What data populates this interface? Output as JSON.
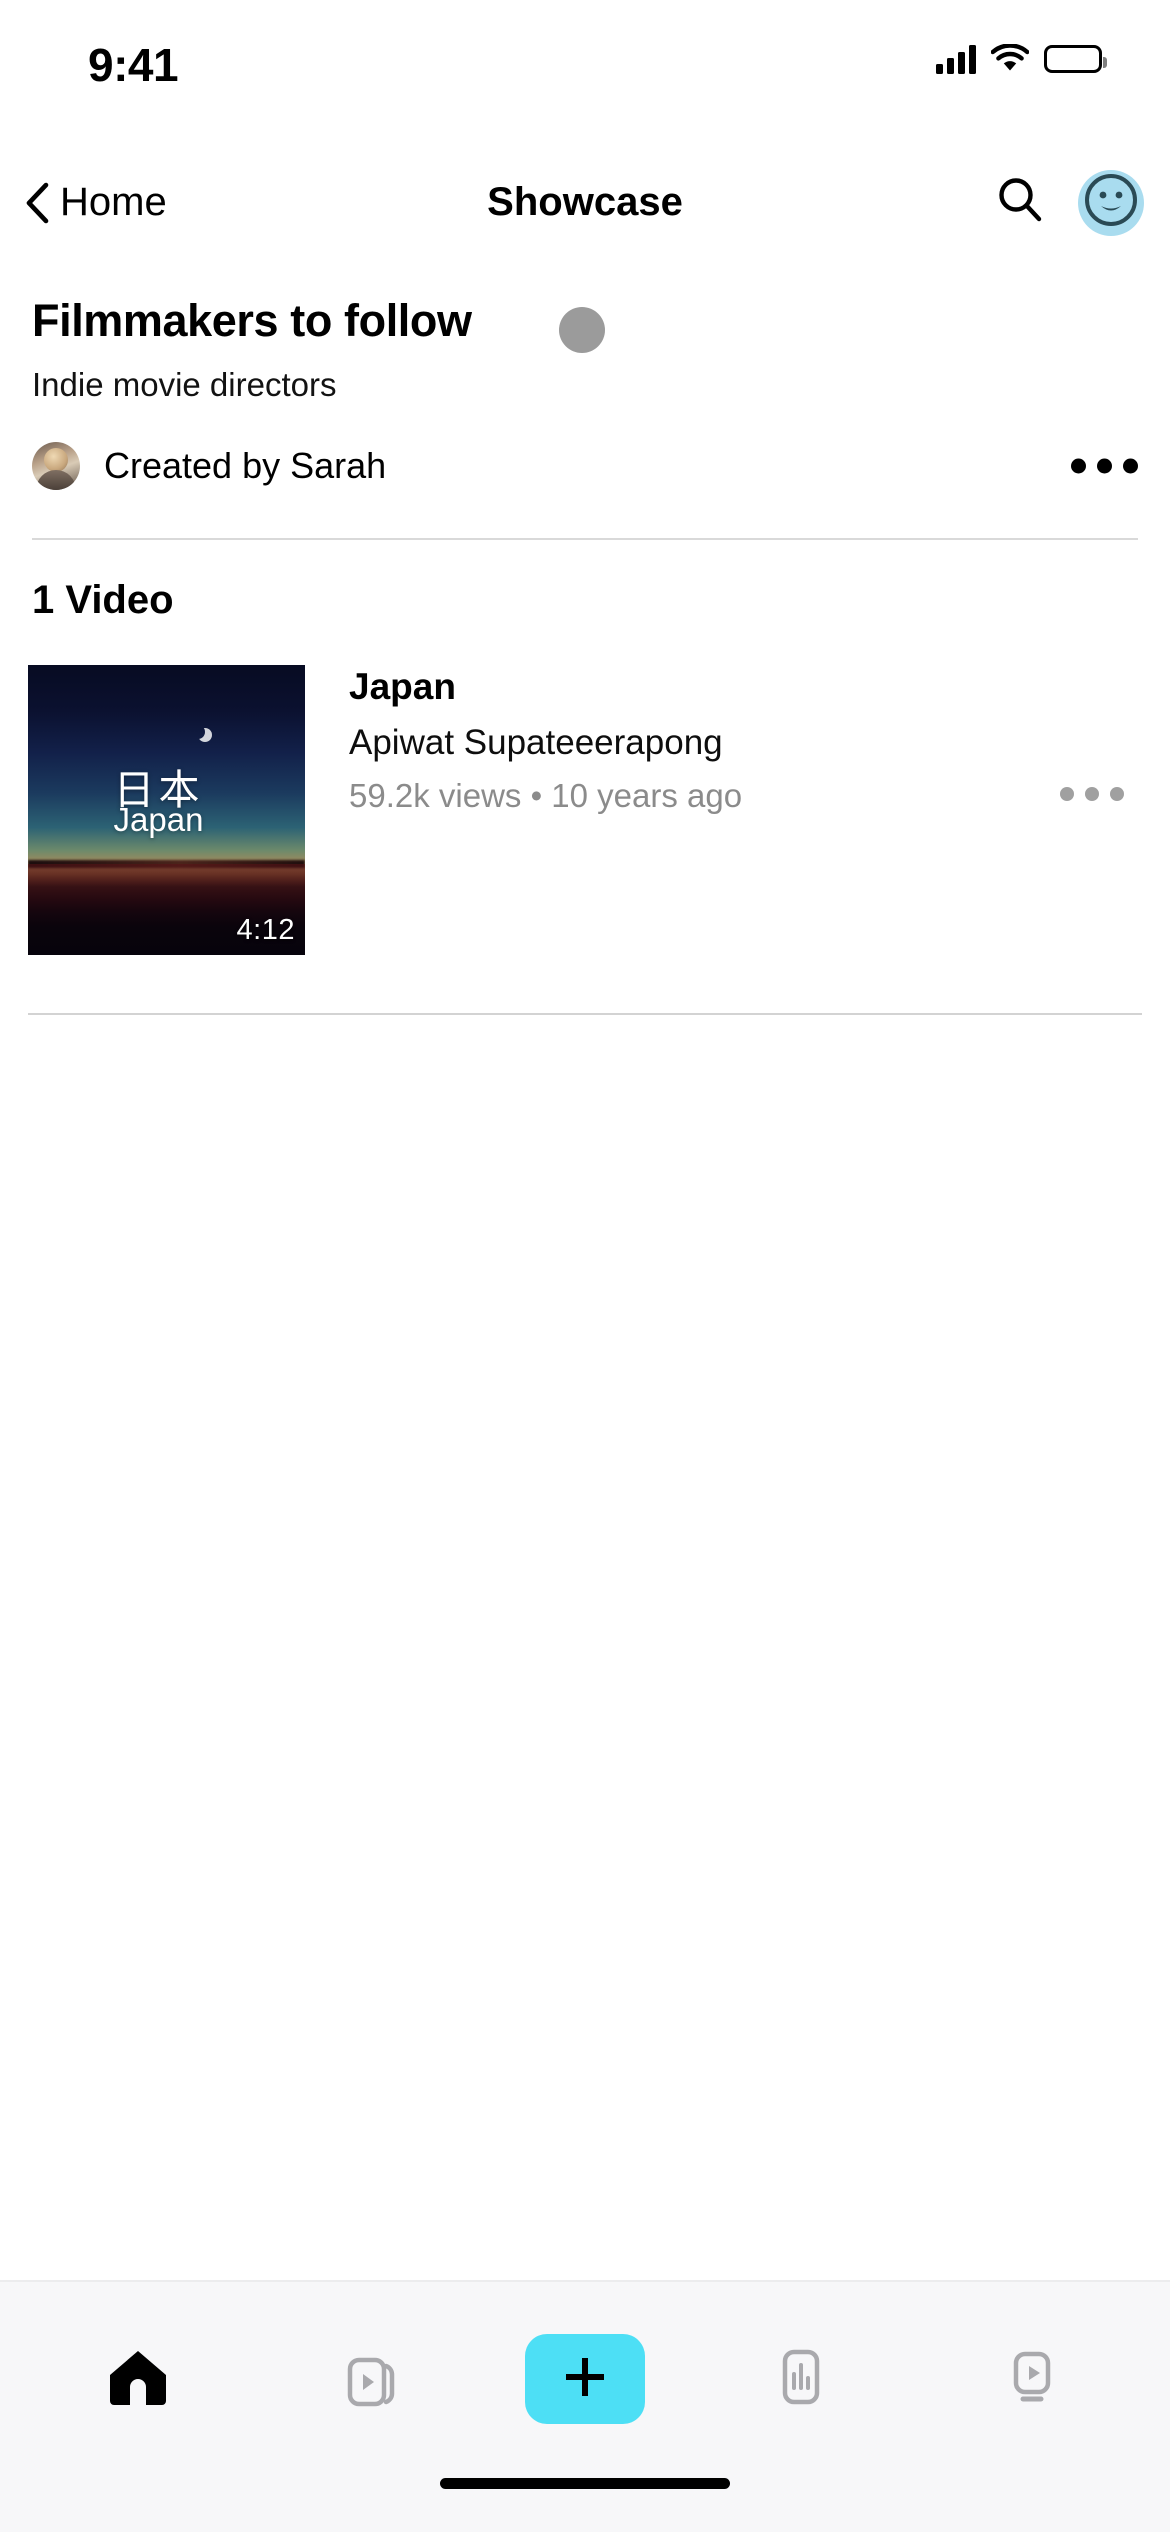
{
  "status_bar": {
    "time": "9:41",
    "cellular_icon": "signal-bars-icon",
    "wifi_icon": "wifi-icon",
    "battery_icon": "battery-full-icon"
  },
  "nav_bar": {
    "back_icon": "chevron-left-icon",
    "back_label": "Home",
    "title": "Showcase",
    "search_icon": "search-icon",
    "avatar_icon": "profile-avatar-icon",
    "avatar_bg": "#a9dcef"
  },
  "playlist": {
    "title": "Filmmakers to follow",
    "subtitle": "Indie movie directors",
    "creator_label": "Created by Sarah",
    "creator_avatar_icon": "creator-avatar-icon",
    "more_icon": "more-horizontal-icon",
    "placeholder_dot_color": "#9b9b9b"
  },
  "section": {
    "count_label": "1 Video"
  },
  "videos": [
    {
      "title": "Japan",
      "channel": "Apiwat Supateeerapong",
      "meta": "59.2k views • 10 years ago",
      "duration": "4:12",
      "thumbnail_kanji": "日本",
      "thumbnail_romaji": "Japan",
      "more_icon": "more-horizontal-icon"
    }
  ],
  "tab_bar": {
    "items": [
      {
        "name": "home",
        "icon": "home-icon",
        "active": true
      },
      {
        "name": "clips",
        "icon": "video-stack-icon",
        "active": false
      },
      {
        "name": "create",
        "icon": "plus-icon",
        "active": false
      },
      {
        "name": "insights",
        "icon": "bar-chart-icon",
        "active": false
      },
      {
        "name": "tv",
        "icon": "tv-play-icon",
        "active": false
      }
    ],
    "create_bg": "#4ddff5"
  },
  "home_indicator": {
    "icon": "home-indicator-bar"
  }
}
